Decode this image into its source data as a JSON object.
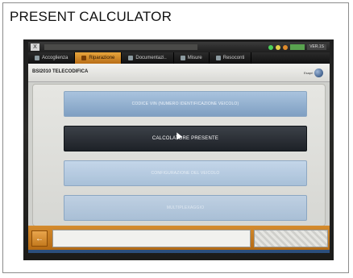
{
  "caption": "PRESENT CALCULATOR",
  "os_bar": {
    "logo": "X",
    "version": "VER.1S"
  },
  "tabs": [
    {
      "label": "Accoglienza",
      "icon": "home-icon"
    },
    {
      "label": "Riparazione",
      "icon": "wrench-icon",
      "active": true
    },
    {
      "label": "Documentazi..",
      "icon": "book-icon"
    },
    {
      "label": "Misure",
      "icon": "gauge-icon"
    },
    {
      "label": "Resoconti",
      "icon": "report-icon"
    }
  ],
  "header": {
    "title": "BSI2010  TELECODIFICA",
    "exit_label": "Esapri"
  },
  "menu": [
    {
      "label": "CODICE VIN (NUMERO IDENTIFICAZIONE VEICOLO)",
      "style": "normal"
    },
    {
      "label": "CALCOLATORE PRESENTE",
      "style": "selected"
    },
    {
      "label": "CONFIGURAZIONE DEL VEICOLO",
      "style": "pale"
    },
    {
      "label": "MULTIPLEXAGGIO",
      "style": "faint"
    }
  ],
  "footer": {
    "back_icon": "back-arrow-icon"
  },
  "colors": {
    "accent_orange": "#d58c2e",
    "button_blue": "#8fb0d2",
    "button_selected": "#23282e"
  }
}
